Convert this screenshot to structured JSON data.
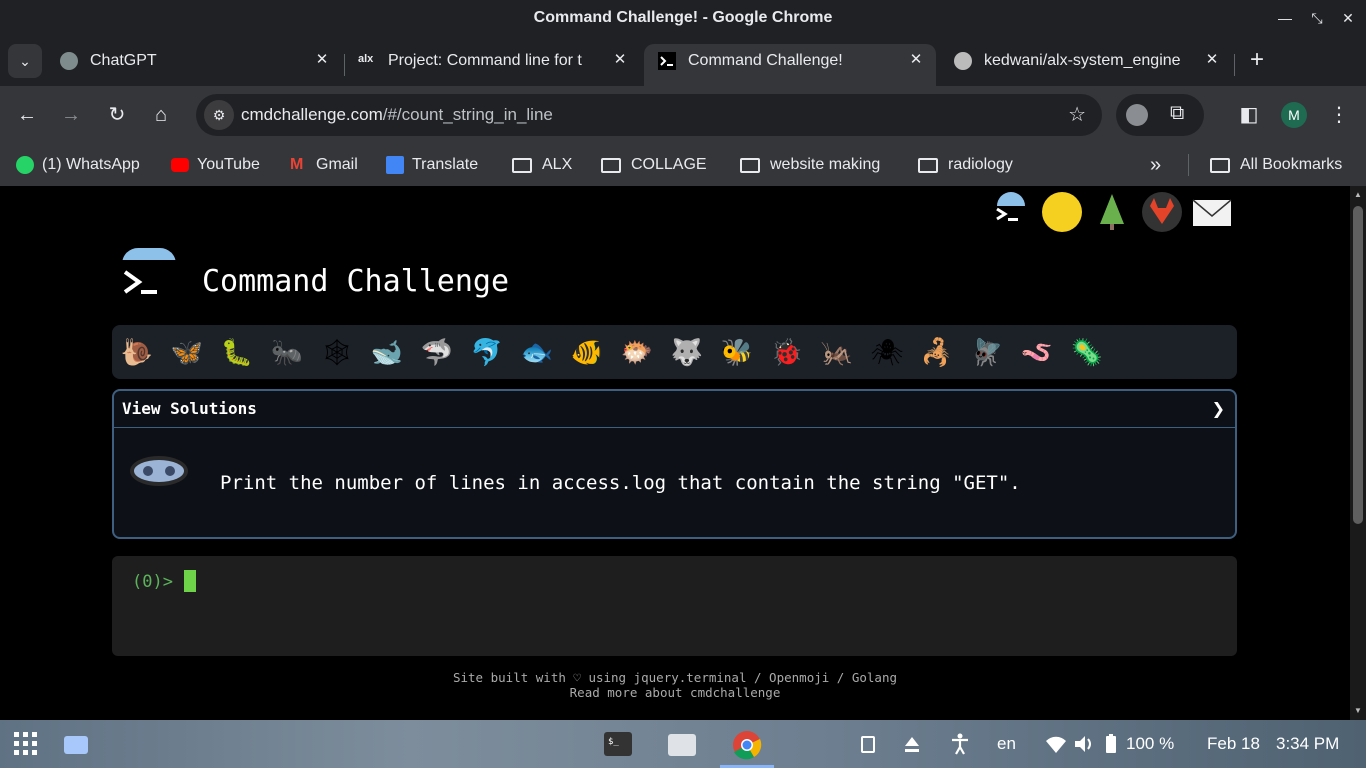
{
  "window": {
    "title": "Command Challenge! - Google Chrome"
  },
  "tabs": [
    {
      "label": "ChatGPT",
      "favicon": "chatgpt-icon"
    },
    {
      "label": "Project: Command line for t",
      "favicon": "alx-icon"
    },
    {
      "label": "Command Challenge!",
      "favicon": "terminal-icon",
      "active": true
    },
    {
      "label": "kedwani/alx-system_engine",
      "favicon": "github-icon"
    }
  ],
  "omnibox": {
    "host": "cmdchallenge.com",
    "path": "/#/count_string_in_line"
  },
  "profile": {
    "initial": "M"
  },
  "bookmarks": [
    {
      "label": "(1) WhatsApp",
      "icon": "whatsapp-icon"
    },
    {
      "label": "YouTube",
      "icon": "youtube-icon"
    },
    {
      "label": "Gmail",
      "icon": "gmail-icon"
    },
    {
      "label": "Translate",
      "icon": "translate-icon"
    },
    {
      "label": "ALX",
      "icon": "folder-icon"
    },
    {
      "label": "COLLAGE",
      "icon": "folder-icon"
    },
    {
      "label": "website making",
      "icon": "folder-icon"
    },
    {
      "label": "radiology",
      "icon": "folder-icon"
    }
  ],
  "all_bookmarks": "All Bookmarks",
  "page": {
    "title": "Command Challenge",
    "view_solutions": "View Solutions",
    "chevron": "❯",
    "task": "Print the number of lines in access.log that contain the string \"GET\".",
    "prompt": "(0)>",
    "footer_line1": "Site built with ♡ using jquery.terminal / Openmoji / Golang",
    "footer_line2": "Read more about cmdchallenge",
    "animals": [
      "🐌",
      "🦋",
      "🐛",
      "🐜",
      "🕸",
      "🐋",
      "🦈",
      "🐬",
      "🐟",
      "🐠",
      "🐡",
      "🐺",
      "🐝",
      "🐞",
      "🦗",
      "🕷",
      "🦂",
      "🪰",
      "🪱",
      "🦠"
    ]
  },
  "shelf": {
    "lang": "en",
    "battery": "100 %",
    "date": "Feb 18",
    "time": "3:34 PM"
  }
}
